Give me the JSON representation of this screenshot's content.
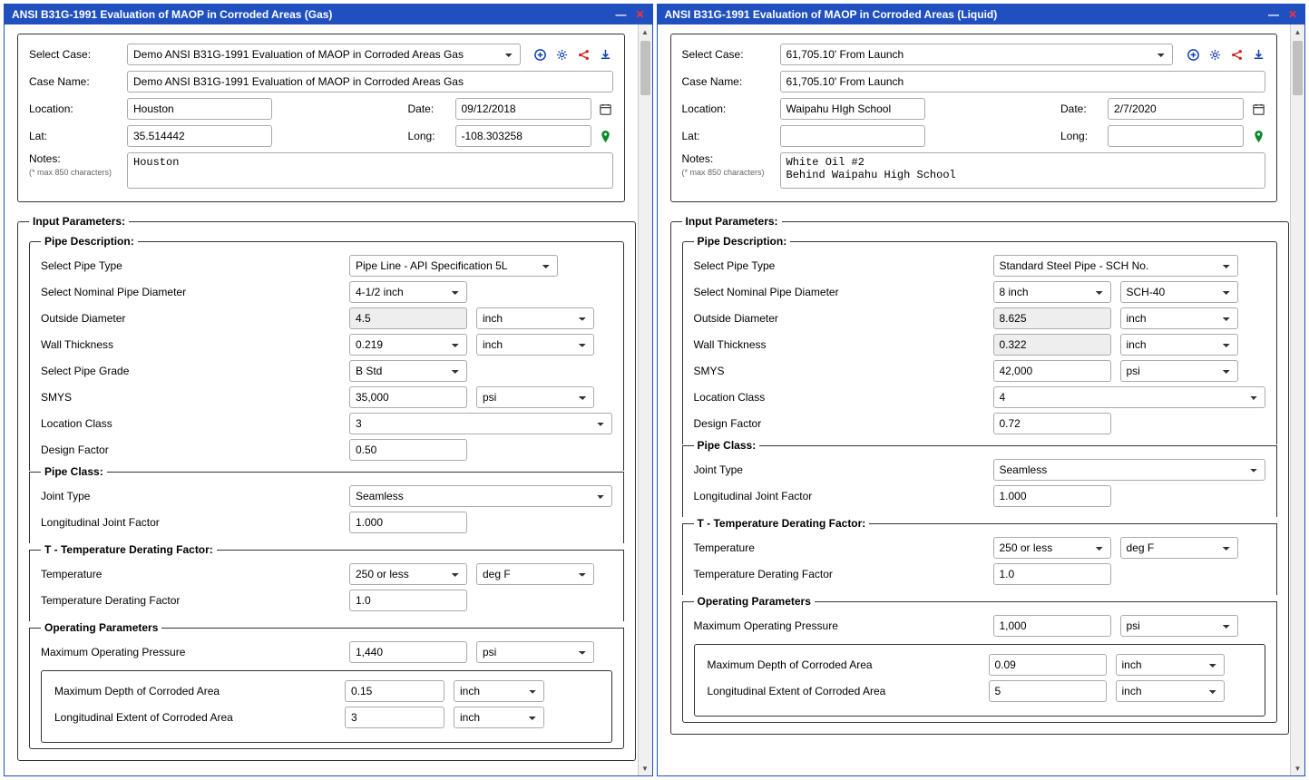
{
  "shared_labels": {
    "select_case": "Select Case:",
    "case_name": "Case Name:",
    "location": "Location:",
    "date": "Date:",
    "lat": "Lat:",
    "long": "Long:",
    "notes": "Notes:",
    "notes_sub": "(* max 850 characters)",
    "input_params": "Input Parameters:",
    "pipe_desc": "Pipe Description:",
    "select_pipe_type": "Select Pipe Type",
    "select_nom_diam": "Select Nominal Pipe Diameter",
    "outside_diam": "Outside Diameter",
    "wall_thickness": "Wall Thickness",
    "select_pipe_grade": "Select Pipe Grade",
    "smys": "SMYS",
    "location_class": "Location Class",
    "design_factor": "Design Factor",
    "pipe_class": "Pipe Class:",
    "joint_type": "Joint Type",
    "long_joint_factor": "Longitudinal Joint Factor",
    "temp_derating": "T - Temperature Derating Factor:",
    "temperature": "Temperature",
    "temp_derating_factor": "Temperature Derating Factor",
    "operating_params": "Operating Parameters",
    "max_op_pressure": "Maximum Operating Pressure",
    "max_depth_corroded": "Maximum Depth of Corroded Area",
    "long_extent_corroded": "Longitudinal Extent of Corroded Area",
    "unit_inch": "inch",
    "unit_psi": "psi",
    "unit_degf": "deg F"
  },
  "left": {
    "title": "ANSI B31G-1991 Evaluation of MAOP in Corroded Areas (Gas)",
    "select_case": "Demo ANSI B31G-1991 Evaluation of MAOP in Corroded Areas Gas",
    "case_name": "Demo ANSI B31G-1991 Evaluation of MAOP in Corroded Areas Gas",
    "location": "Houston",
    "date": "09/12/2018",
    "lat": "35.514442",
    "long": "-108.303258",
    "notes": "Houston",
    "pipe_type": "Pipe Line - API Specification 5L",
    "nom_diam": "4-1/2 inch",
    "outside_diam": "4.5",
    "wall_thickness": "0.219",
    "pipe_grade": "B Std",
    "smys": "35,000",
    "location_class": "3",
    "design_factor": "0.50",
    "joint_type": "Seamless",
    "long_joint_factor": "1.000",
    "temperature": "250 or less",
    "temp_derating_factor": "1.0",
    "max_op_pressure": "1,440",
    "max_depth_corroded": "0.15",
    "long_extent_corroded": "3"
  },
  "right": {
    "title": "ANSI B31G-1991 Evaluation of MAOP in Corroded Areas (Liquid)",
    "select_case": "61,705.10' From Launch",
    "case_name": "61,705.10' From Launch",
    "location": "Waipahu HIgh School",
    "date": "2/7/2020",
    "lat": "",
    "long": "",
    "notes": "White Oil #2\nBehind Waipahu High School",
    "pipe_type": "Standard Steel Pipe - SCH No.",
    "nom_diam": "8 inch",
    "sch": "SCH-40",
    "outside_diam": "8.625",
    "wall_thickness": "0.322",
    "smys": "42,000",
    "location_class": "4",
    "design_factor": "0.72",
    "joint_type": "Seamless",
    "long_joint_factor": "1.000",
    "temperature": "250 or less",
    "temp_derating_factor": "1.0",
    "max_op_pressure": "1,000",
    "max_depth_corroded": "0.09",
    "long_extent_corroded": "5"
  }
}
